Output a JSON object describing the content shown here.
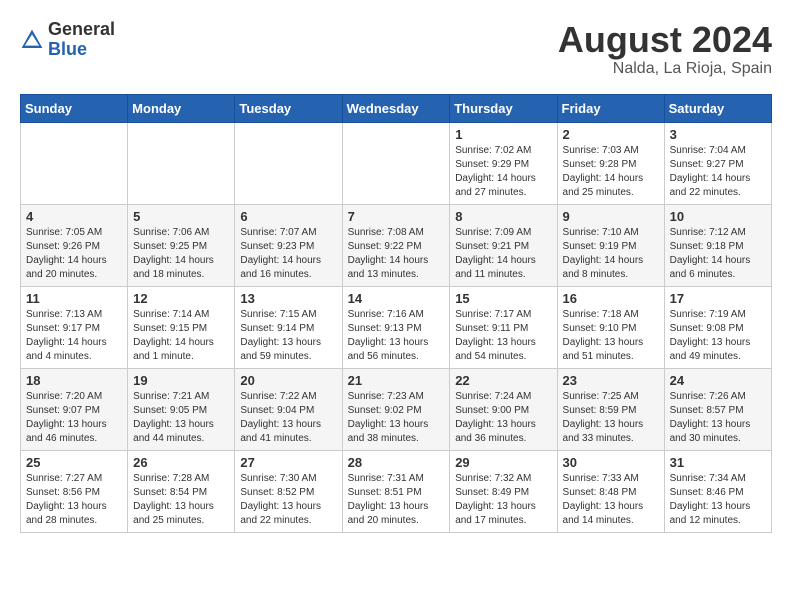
{
  "header": {
    "logo_general": "General",
    "logo_blue": "Blue",
    "month_year": "August 2024",
    "location": "Nalda, La Rioja, Spain"
  },
  "days_of_week": [
    "Sunday",
    "Monday",
    "Tuesday",
    "Wednesday",
    "Thursday",
    "Friday",
    "Saturday"
  ],
  "weeks": [
    [
      {
        "day": "",
        "info": ""
      },
      {
        "day": "",
        "info": ""
      },
      {
        "day": "",
        "info": ""
      },
      {
        "day": "",
        "info": ""
      },
      {
        "day": "1",
        "info": "Sunrise: 7:02 AM\nSunset: 9:29 PM\nDaylight: 14 hours and 27 minutes."
      },
      {
        "day": "2",
        "info": "Sunrise: 7:03 AM\nSunset: 9:28 PM\nDaylight: 14 hours and 25 minutes."
      },
      {
        "day": "3",
        "info": "Sunrise: 7:04 AM\nSunset: 9:27 PM\nDaylight: 14 hours and 22 minutes."
      }
    ],
    [
      {
        "day": "4",
        "info": "Sunrise: 7:05 AM\nSunset: 9:26 PM\nDaylight: 14 hours and 20 minutes."
      },
      {
        "day": "5",
        "info": "Sunrise: 7:06 AM\nSunset: 9:25 PM\nDaylight: 14 hours and 18 minutes."
      },
      {
        "day": "6",
        "info": "Sunrise: 7:07 AM\nSunset: 9:23 PM\nDaylight: 14 hours and 16 minutes."
      },
      {
        "day": "7",
        "info": "Sunrise: 7:08 AM\nSunset: 9:22 PM\nDaylight: 14 hours and 13 minutes."
      },
      {
        "day": "8",
        "info": "Sunrise: 7:09 AM\nSunset: 9:21 PM\nDaylight: 14 hours and 11 minutes."
      },
      {
        "day": "9",
        "info": "Sunrise: 7:10 AM\nSunset: 9:19 PM\nDaylight: 14 hours and 8 minutes."
      },
      {
        "day": "10",
        "info": "Sunrise: 7:12 AM\nSunset: 9:18 PM\nDaylight: 14 hours and 6 minutes."
      }
    ],
    [
      {
        "day": "11",
        "info": "Sunrise: 7:13 AM\nSunset: 9:17 PM\nDaylight: 14 hours and 4 minutes."
      },
      {
        "day": "12",
        "info": "Sunrise: 7:14 AM\nSunset: 9:15 PM\nDaylight: 14 hours and 1 minute."
      },
      {
        "day": "13",
        "info": "Sunrise: 7:15 AM\nSunset: 9:14 PM\nDaylight: 13 hours and 59 minutes."
      },
      {
        "day": "14",
        "info": "Sunrise: 7:16 AM\nSunset: 9:13 PM\nDaylight: 13 hours and 56 minutes."
      },
      {
        "day": "15",
        "info": "Sunrise: 7:17 AM\nSunset: 9:11 PM\nDaylight: 13 hours and 54 minutes."
      },
      {
        "day": "16",
        "info": "Sunrise: 7:18 AM\nSunset: 9:10 PM\nDaylight: 13 hours and 51 minutes."
      },
      {
        "day": "17",
        "info": "Sunrise: 7:19 AM\nSunset: 9:08 PM\nDaylight: 13 hours and 49 minutes."
      }
    ],
    [
      {
        "day": "18",
        "info": "Sunrise: 7:20 AM\nSunset: 9:07 PM\nDaylight: 13 hours and 46 minutes."
      },
      {
        "day": "19",
        "info": "Sunrise: 7:21 AM\nSunset: 9:05 PM\nDaylight: 13 hours and 44 minutes."
      },
      {
        "day": "20",
        "info": "Sunrise: 7:22 AM\nSunset: 9:04 PM\nDaylight: 13 hours and 41 minutes."
      },
      {
        "day": "21",
        "info": "Sunrise: 7:23 AM\nSunset: 9:02 PM\nDaylight: 13 hours and 38 minutes."
      },
      {
        "day": "22",
        "info": "Sunrise: 7:24 AM\nSunset: 9:00 PM\nDaylight: 13 hours and 36 minutes."
      },
      {
        "day": "23",
        "info": "Sunrise: 7:25 AM\nSunset: 8:59 PM\nDaylight: 13 hours and 33 minutes."
      },
      {
        "day": "24",
        "info": "Sunrise: 7:26 AM\nSunset: 8:57 PM\nDaylight: 13 hours and 30 minutes."
      }
    ],
    [
      {
        "day": "25",
        "info": "Sunrise: 7:27 AM\nSunset: 8:56 PM\nDaylight: 13 hours and 28 minutes."
      },
      {
        "day": "26",
        "info": "Sunrise: 7:28 AM\nSunset: 8:54 PM\nDaylight: 13 hours and 25 minutes."
      },
      {
        "day": "27",
        "info": "Sunrise: 7:30 AM\nSunset: 8:52 PM\nDaylight: 13 hours and 22 minutes."
      },
      {
        "day": "28",
        "info": "Sunrise: 7:31 AM\nSunset: 8:51 PM\nDaylight: 13 hours and 20 minutes."
      },
      {
        "day": "29",
        "info": "Sunrise: 7:32 AM\nSunset: 8:49 PM\nDaylight: 13 hours and 17 minutes."
      },
      {
        "day": "30",
        "info": "Sunrise: 7:33 AM\nSunset: 8:48 PM\nDaylight: 13 hours and 14 minutes."
      },
      {
        "day": "31",
        "info": "Sunrise: 7:34 AM\nSunset: 8:46 PM\nDaylight: 13 hours and 12 minutes."
      }
    ]
  ]
}
